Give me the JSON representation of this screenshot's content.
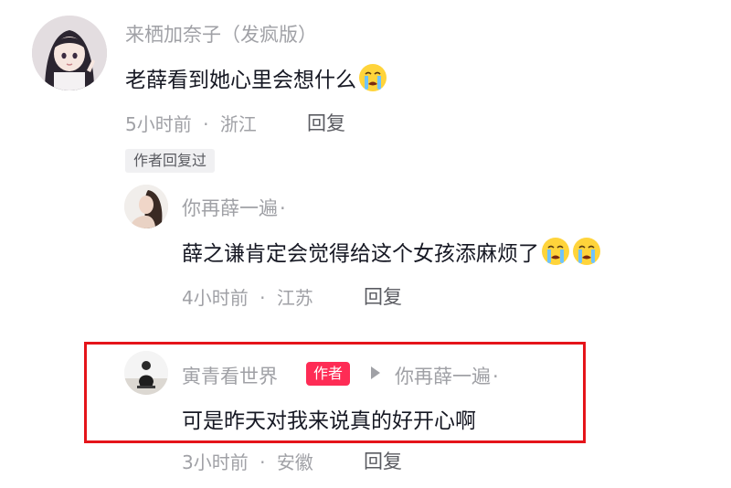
{
  "comment": {
    "username": "来栖加奈子（发疯版）",
    "text": "老薛看到她心里会想什么",
    "emoji": "crying-emoji",
    "time": "5小时前",
    "location": "浙江",
    "reply_label": "回复",
    "author_replied_badge": "作者回复过"
  },
  "replies": [
    {
      "username": "你再薛一遍",
      "separator": "·",
      "text": "薛之谦肯定会觉得给这个女孩添麻烦了",
      "emojis": [
        "crying-emoji",
        "crying-emoji"
      ],
      "time": "4小时前",
      "location": "江苏",
      "reply_label": "回复"
    },
    {
      "username": "寅青看世界",
      "author_tag": "作者",
      "reply_to_icon": "play-arrow-icon",
      "reply_to": "你再薛一遍",
      "separator": "·",
      "text": "可是昨天对我来说真的好开心啊",
      "time": "3小时前",
      "location": "安徽",
      "reply_label": "回复",
      "highlighted": true
    }
  ],
  "meta_separator": "·",
  "colors": {
    "highlight_border": "#e5141a",
    "author_tag_bg": "#fe2c55",
    "secondary_text": "#a0a1a6"
  }
}
